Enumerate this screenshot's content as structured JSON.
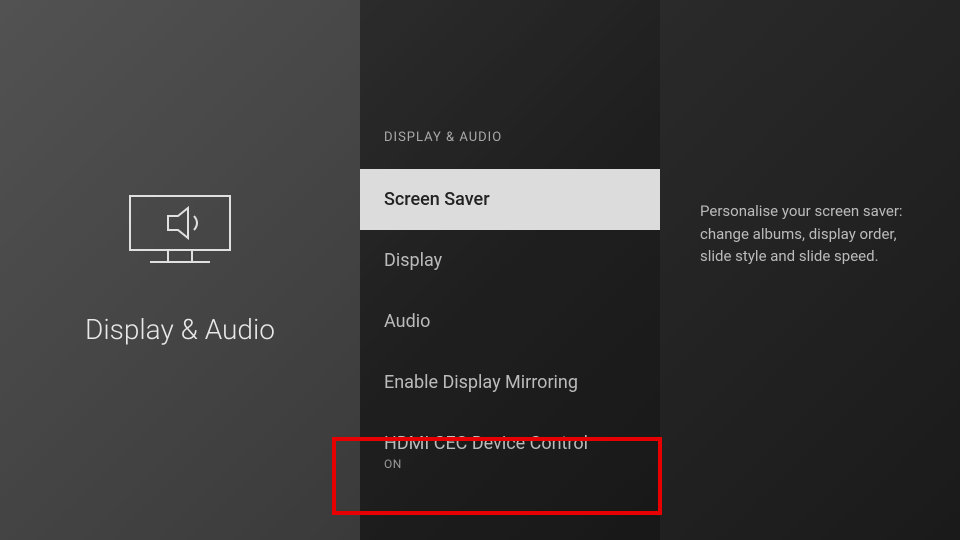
{
  "left": {
    "categoryTitle": "Display & Audio"
  },
  "center": {
    "breadcrumb": "DISPLAY & AUDIO",
    "items": [
      {
        "label": "Screen Saver",
        "sublabel": ""
      },
      {
        "label": "Display",
        "sublabel": ""
      },
      {
        "label": "Audio",
        "sublabel": ""
      },
      {
        "label": "Enable Display Mirroring",
        "sublabel": ""
      },
      {
        "label": "HDMI CEC Device Control",
        "sublabel": "ON"
      }
    ]
  },
  "right": {
    "description": "Personalise your screen saver: change albums, display order, slide style and slide speed."
  }
}
